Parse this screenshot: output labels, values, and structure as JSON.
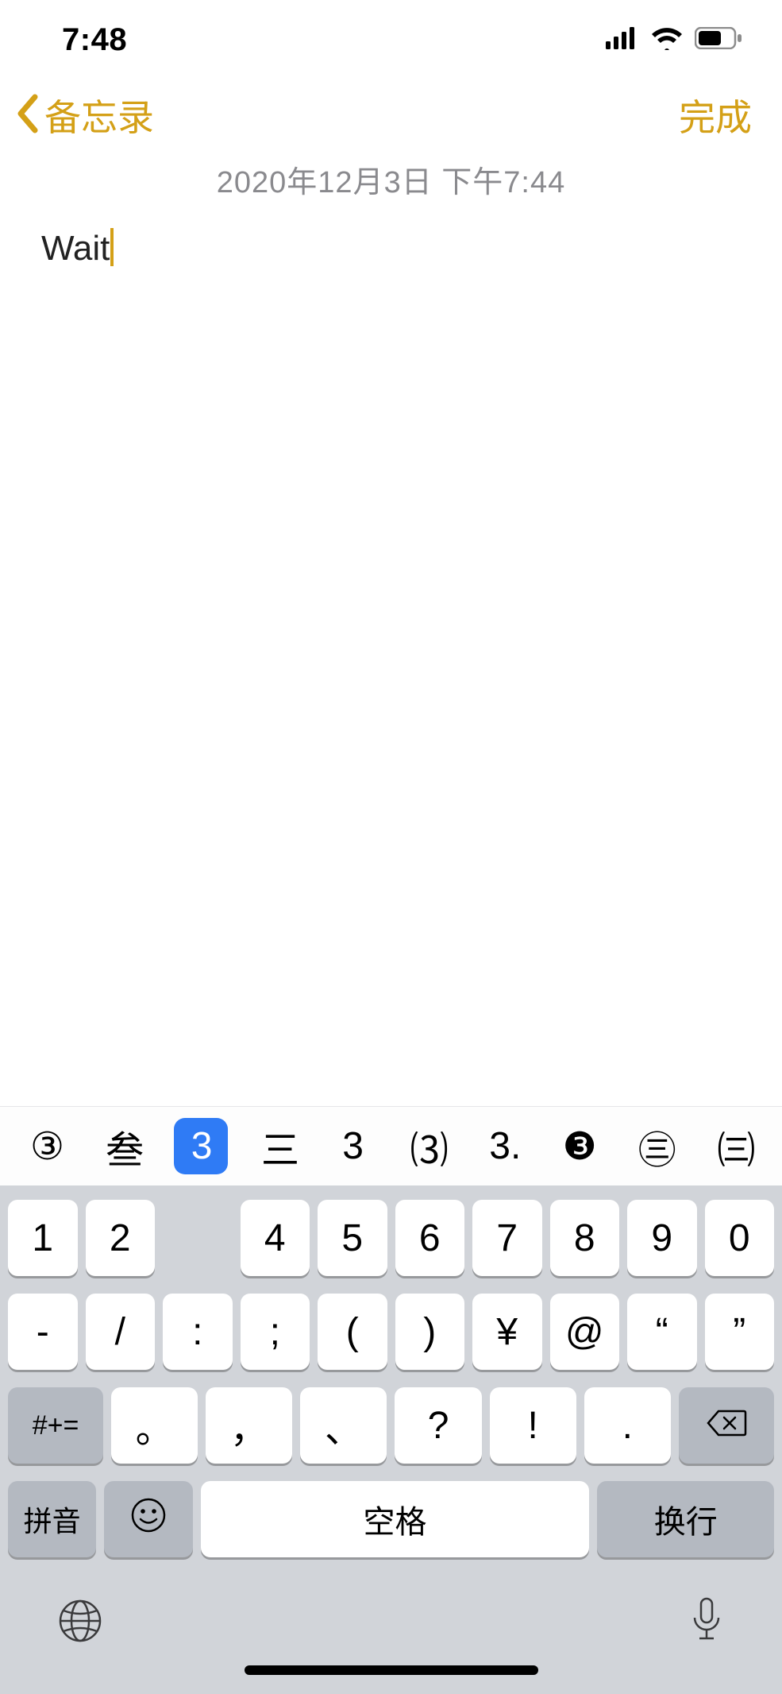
{
  "status": {
    "time": "7:48"
  },
  "nav": {
    "back_label": "备忘录",
    "done_label": "完成"
  },
  "note": {
    "timestamp": "2020年12月3日 下午7:44",
    "text": "Wait"
  },
  "candidates": {
    "items": [
      "③",
      "叁",
      "3",
      "三",
      "3",
      "⑶",
      "3.",
      "❸",
      "㊂",
      "㈢"
    ],
    "selected_index": 2
  },
  "keyboard": {
    "row1": [
      "1",
      "2",
      "",
      "4",
      "5",
      "6",
      "7",
      "8",
      "9",
      "0"
    ],
    "row2": [
      "-",
      "/",
      ":",
      ";",
      "(",
      ")",
      "¥",
      "@",
      "“",
      "”"
    ],
    "row3": {
      "shift": "#+=",
      "keys": [
        "。",
        "，",
        "、",
        "?",
        "!",
        "."
      ]
    },
    "row4": {
      "pinyin": "拼音",
      "space": "空格",
      "return": "换行"
    }
  }
}
